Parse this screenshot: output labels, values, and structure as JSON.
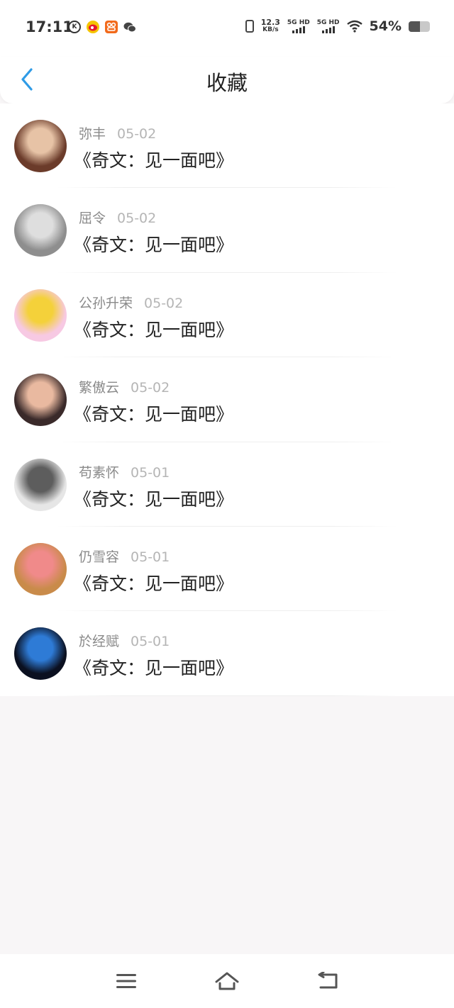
{
  "status_bar": {
    "time": "17:11",
    "speed_value": "12.3",
    "speed_unit": "KB/s",
    "sim1_label": "5G HD",
    "sim2_label": "5G HD",
    "battery_text": "54%",
    "battery_level": 0.54,
    "app_icons": [
      "k-icon",
      "weibo-icon",
      "app-icon",
      "wechat-icon"
    ]
  },
  "header": {
    "title": "收藏",
    "accent_color": "#2f9be6"
  },
  "favorites": [
    {
      "user": "弥丰",
      "date": "05-02",
      "title": "《奇文：见一面吧》",
      "avatar": {
        "bg": "#6b3b2a",
        "fg": "#e7c3a6"
      }
    },
    {
      "user": "屈令",
      "date": "05-02",
      "title": "《奇文：见一面吧》",
      "avatar": {
        "bg": "#8e8e8e",
        "fg": "#dedede"
      }
    },
    {
      "user": "公孙升荣",
      "date": "05-02",
      "title": "《奇文：见一面吧》",
      "avatar": {
        "bg": "#f7c9e3",
        "fg": "#f4d13a"
      }
    },
    {
      "user": "繁傲云",
      "date": "05-02",
      "title": "《奇文：见一面吧》",
      "avatar": {
        "bg": "#3a2a2a",
        "fg": "#e9b9a0"
      }
    },
    {
      "user": "苟素怀",
      "date": "05-01",
      "title": "《奇文：见一面吧》",
      "avatar": {
        "bg": "#e6e6e6",
        "fg": "#5d5d5d"
      }
    },
    {
      "user": "仍雪容",
      "date": "05-01",
      "title": "《奇文：见一面吧》",
      "avatar": {
        "bg": "#c98b4a",
        "fg": "#f08a8a"
      }
    },
    {
      "user": "於经赋",
      "date": "05-01",
      "title": "《奇文：见一面吧》",
      "avatar": {
        "bg": "#0b1020",
        "fg": "#2e7bd6"
      }
    }
  ],
  "bottom_nav": [
    "menu-icon",
    "home-icon",
    "back-icon"
  ]
}
